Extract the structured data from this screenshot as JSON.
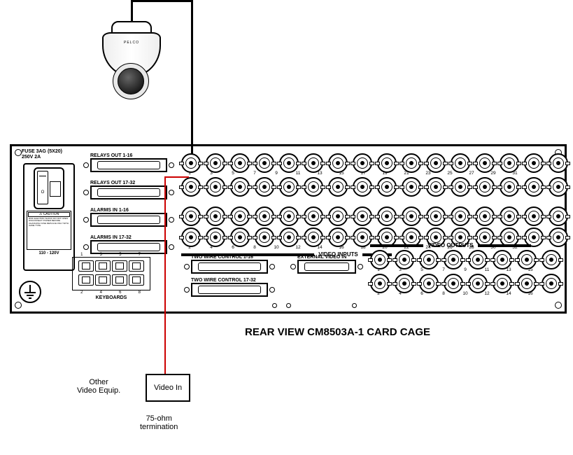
{
  "camera_brand": "PELCO",
  "main_title": "REAR VIEW CM8503A-1 CARD CAGE",
  "power": {
    "fuse_label": "FUSE 3AG (5X20)\n250V 2A",
    "warning": "CAUTION",
    "voltage": "110 - 120V"
  },
  "db_ports": [
    {
      "label": "RELAYS OUT 1-16"
    },
    {
      "label": "RELAYS OUT 17-32"
    },
    {
      "label": "ALARMS IN 1-16"
    },
    {
      "label": "ALARMS IN 17-32"
    }
  ],
  "keyboards": {
    "group_label": "KEYBOARDS",
    "top_nums": [
      "1",
      "3",
      "5",
      "7"
    ],
    "bottom_nums": [
      "2",
      "4",
      "6",
      "8"
    ]
  },
  "video_inputs": {
    "section_label": "VIDEO INPUTS",
    "row1": [
      "1",
      "3",
      "5",
      "7",
      "9",
      "11",
      "13",
      "15",
      "17",
      "19",
      "21",
      "23",
      "25",
      "27",
      "29",
      "31"
    ],
    "row2": [
      "2",
      "4",
      "6",
      "8",
      "10",
      "12",
      "14",
      "16",
      "18",
      "20",
      "22",
      "24",
      "26",
      "28",
      "30",
      "32"
    ]
  },
  "two_wire": [
    {
      "label": "TWO WIRE CONTROL 1-16"
    },
    {
      "label": "TWO WIRE CONTROL 17-32"
    }
  ],
  "ext_video_label": "EXTERNAL VIDEO IN",
  "video_outputs": {
    "section_label": "VIDEO OUTPUTS",
    "row1": [
      "1",
      "3",
      "5",
      "7",
      "9",
      "11",
      "13",
      "15"
    ],
    "row2": [
      "2",
      "4",
      "6",
      "8",
      "10",
      "12",
      "14",
      "16"
    ]
  },
  "callouts": {
    "other_equip": "Other\nVideo Equip.",
    "video_in_box": "Video In",
    "termination": "75-ohm\ntermination"
  }
}
